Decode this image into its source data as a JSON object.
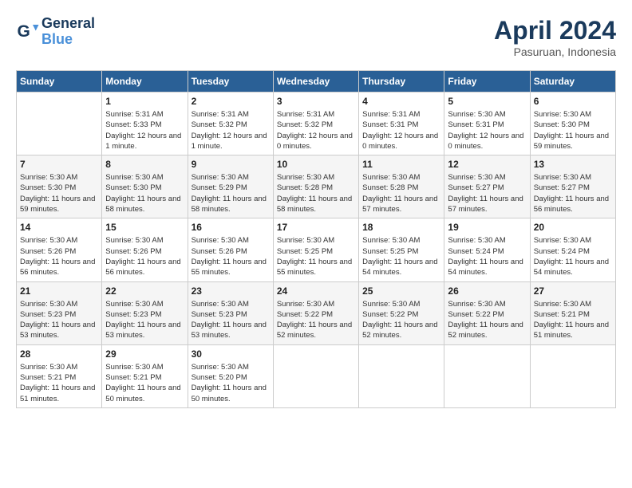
{
  "header": {
    "logo_line1": "General",
    "logo_line2": "Blue",
    "month": "April 2024",
    "location": "Pasuruan, Indonesia"
  },
  "weekdays": [
    "Sunday",
    "Monday",
    "Tuesday",
    "Wednesday",
    "Thursday",
    "Friday",
    "Saturday"
  ],
  "weeks": [
    [
      {
        "day": null
      },
      {
        "day": "1",
        "sunrise": "5:31 AM",
        "sunset": "5:33 PM",
        "daylight": "12 hours and 1 minute."
      },
      {
        "day": "2",
        "sunrise": "5:31 AM",
        "sunset": "5:32 PM",
        "daylight": "12 hours and 1 minute."
      },
      {
        "day": "3",
        "sunrise": "5:31 AM",
        "sunset": "5:32 PM",
        "daylight": "12 hours and 0 minutes."
      },
      {
        "day": "4",
        "sunrise": "5:31 AM",
        "sunset": "5:31 PM",
        "daylight": "12 hours and 0 minutes."
      },
      {
        "day": "5",
        "sunrise": "5:30 AM",
        "sunset": "5:31 PM",
        "daylight": "12 hours and 0 minutes."
      },
      {
        "day": "6",
        "sunrise": "5:30 AM",
        "sunset": "5:30 PM",
        "daylight": "11 hours and 59 minutes."
      }
    ],
    [
      {
        "day": "7",
        "sunrise": "5:30 AM",
        "sunset": "5:30 PM",
        "daylight": "11 hours and 59 minutes."
      },
      {
        "day": "8",
        "sunrise": "5:30 AM",
        "sunset": "5:30 PM",
        "daylight": "11 hours and 58 minutes."
      },
      {
        "day": "9",
        "sunrise": "5:30 AM",
        "sunset": "5:29 PM",
        "daylight": "11 hours and 58 minutes."
      },
      {
        "day": "10",
        "sunrise": "5:30 AM",
        "sunset": "5:28 PM",
        "daylight": "11 hours and 58 minutes."
      },
      {
        "day": "11",
        "sunrise": "5:30 AM",
        "sunset": "5:28 PM",
        "daylight": "11 hours and 57 minutes."
      },
      {
        "day": "12",
        "sunrise": "5:30 AM",
        "sunset": "5:27 PM",
        "daylight": "11 hours and 57 minutes."
      },
      {
        "day": "13",
        "sunrise": "5:30 AM",
        "sunset": "5:27 PM",
        "daylight": "11 hours and 56 minutes."
      }
    ],
    [
      {
        "day": "14",
        "sunrise": "5:30 AM",
        "sunset": "5:26 PM",
        "daylight": "11 hours and 56 minutes."
      },
      {
        "day": "15",
        "sunrise": "5:30 AM",
        "sunset": "5:26 PM",
        "daylight": "11 hours and 56 minutes."
      },
      {
        "day": "16",
        "sunrise": "5:30 AM",
        "sunset": "5:26 PM",
        "daylight": "11 hours and 55 minutes."
      },
      {
        "day": "17",
        "sunrise": "5:30 AM",
        "sunset": "5:25 PM",
        "daylight": "11 hours and 55 minutes."
      },
      {
        "day": "18",
        "sunrise": "5:30 AM",
        "sunset": "5:25 PM",
        "daylight": "11 hours and 54 minutes."
      },
      {
        "day": "19",
        "sunrise": "5:30 AM",
        "sunset": "5:24 PM",
        "daylight": "11 hours and 54 minutes."
      },
      {
        "day": "20",
        "sunrise": "5:30 AM",
        "sunset": "5:24 PM",
        "daylight": "11 hours and 54 minutes."
      }
    ],
    [
      {
        "day": "21",
        "sunrise": "5:30 AM",
        "sunset": "5:23 PM",
        "daylight": "11 hours and 53 minutes."
      },
      {
        "day": "22",
        "sunrise": "5:30 AM",
        "sunset": "5:23 PM",
        "daylight": "11 hours and 53 minutes."
      },
      {
        "day": "23",
        "sunrise": "5:30 AM",
        "sunset": "5:23 PM",
        "daylight": "11 hours and 53 minutes."
      },
      {
        "day": "24",
        "sunrise": "5:30 AM",
        "sunset": "5:22 PM",
        "daylight": "11 hours and 52 minutes."
      },
      {
        "day": "25",
        "sunrise": "5:30 AM",
        "sunset": "5:22 PM",
        "daylight": "11 hours and 52 minutes."
      },
      {
        "day": "26",
        "sunrise": "5:30 AM",
        "sunset": "5:22 PM",
        "daylight": "11 hours and 52 minutes."
      },
      {
        "day": "27",
        "sunrise": "5:30 AM",
        "sunset": "5:21 PM",
        "daylight": "11 hours and 51 minutes."
      }
    ],
    [
      {
        "day": "28",
        "sunrise": "5:30 AM",
        "sunset": "5:21 PM",
        "daylight": "11 hours and 51 minutes."
      },
      {
        "day": "29",
        "sunrise": "5:30 AM",
        "sunset": "5:21 PM",
        "daylight": "11 hours and 50 minutes."
      },
      {
        "day": "30",
        "sunrise": "5:30 AM",
        "sunset": "5:20 PM",
        "daylight": "11 hours and 50 minutes."
      },
      {
        "day": null
      },
      {
        "day": null
      },
      {
        "day": null
      },
      {
        "day": null
      }
    ]
  ]
}
